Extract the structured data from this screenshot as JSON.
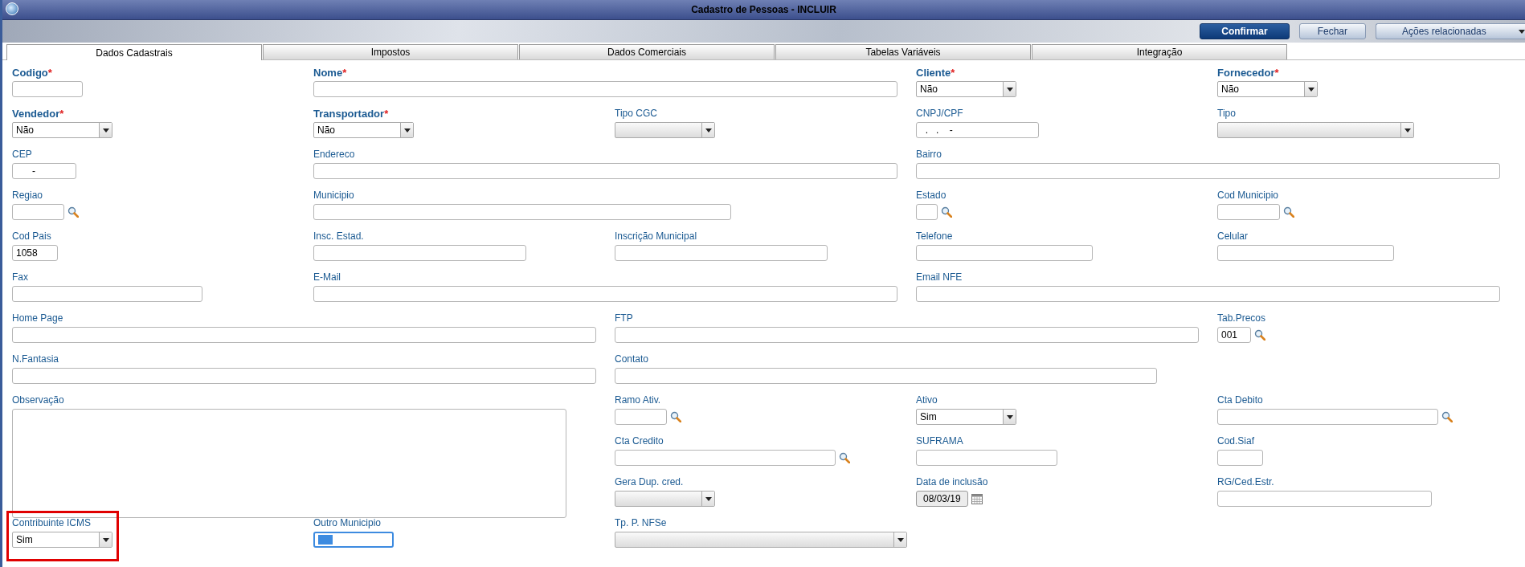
{
  "window": {
    "title": "Cadastro de Pessoas - INCLUIR"
  },
  "buttons": [
    {
      "label": "Confirmar",
      "kind": "primary"
    },
    {
      "label": "Fechar",
      "kind": "default"
    },
    {
      "label": "Ações relacionadas",
      "kind": "menu"
    }
  ],
  "tabs": [
    {
      "label": "Dados Cadastrais",
      "selected": true
    },
    {
      "label": "Impostos",
      "selected": false
    },
    {
      "label": "Dados Comerciais",
      "selected": false
    },
    {
      "label": "Tabelas Variáveis",
      "selected": false
    },
    {
      "label": "Integração",
      "selected": false
    }
  ],
  "fields": [
    {
      "label": "Codigo",
      "required_mark": "*",
      "kind": "text",
      "disabled": false,
      "focused": false,
      "highlighted": false
    },
    {
      "label": "Nome",
      "required_mark": "*",
      "kind": "text",
      "disabled": false,
      "focused": false,
      "highlighted": false
    },
    {
      "label": "Cliente",
      "required_mark": "*",
      "kind": "select",
      "value": "Não",
      "disabled": false,
      "focused": false,
      "highlighted": false
    },
    {
      "label": "Fornecedor",
      "required_mark": "*",
      "kind": "select",
      "value": "Não",
      "disabled": false,
      "focused": false,
      "highlighted": false
    },
    {
      "label": "Vendedor",
      "required_mark": "*",
      "kind": "select",
      "value": "Não",
      "disabled": false,
      "focused": false,
      "highlighted": false
    },
    {
      "label": "Transportador",
      "required_mark": "*",
      "kind": "select",
      "value": "Não",
      "disabled": false,
      "focused": false,
      "highlighted": false
    },
    {
      "label": "Tipo CGC",
      "kind": "select",
      "disabled": true,
      "focused": false,
      "highlighted": false
    },
    {
      "label": "CNPJ/CPF",
      "kind": "text",
      "value": "  .   .    -",
      "disabled": false,
      "focused": false,
      "highlighted": false
    },
    {
      "label": "Tipo",
      "kind": "select",
      "disabled": true,
      "focused": false,
      "highlighted": false
    },
    {
      "label": "CEP",
      "kind": "text",
      "value": "      -",
      "disabled": false,
      "focused": false,
      "highlighted": false
    },
    {
      "label": "Endereco",
      "kind": "text",
      "disabled": false,
      "focused": false,
      "highlighted": false
    },
    {
      "label": "Bairro",
      "kind": "text",
      "disabled": false,
      "focused": false,
      "highlighted": false
    },
    {
      "label": "Regiao",
      "kind": "lookup",
      "disabled": false,
      "focused": false,
      "highlighted": false
    },
    {
      "label": "Municipio",
      "kind": "text",
      "disabled": false,
      "focused": false,
      "highlighted": false
    },
    {
      "label": "Estado",
      "kind": "lookup",
      "disabled": false,
      "focused": false,
      "highlighted": false
    },
    {
      "label": "Cod Municipio",
      "kind": "lookup",
      "disabled": false,
      "focused": false,
      "highlighted": false
    },
    {
      "label": "Cod Pais",
      "kind": "text",
      "value": "1058",
      "disabled": false,
      "focused": false,
      "highlighted": false
    },
    {
      "label": "Insc. Estad.",
      "kind": "text",
      "disabled": false,
      "focused": false,
      "highlighted": false
    },
    {
      "label": "Inscrição Municipal",
      "kind": "text",
      "disabled": false,
      "focused": false,
      "highlighted": false
    },
    {
      "label": "Telefone",
      "kind": "text",
      "disabled": false,
      "focused": false,
      "highlighted": false
    },
    {
      "label": "Celular",
      "kind": "text",
      "disabled": false,
      "focused": false,
      "highlighted": false
    },
    {
      "label": "Fax",
      "kind": "text",
      "disabled": false,
      "focused": false,
      "highlighted": false
    },
    {
      "label": "E-Mail",
      "kind": "text",
      "disabled": false,
      "focused": false,
      "highlighted": false
    },
    {
      "label": "Email NFE",
      "kind": "text",
      "disabled": false,
      "focused": false,
      "highlighted": false
    },
    {
      "label": "Home Page",
      "kind": "text",
      "disabled": false,
      "focused": false,
      "highlighted": false
    },
    {
      "label": "FTP",
      "kind": "text",
      "disabled": false,
      "focused": false,
      "highlighted": false
    },
    {
      "label": "Tab.Precos",
      "kind": "lookup",
      "value": "001",
      "disabled": false,
      "focused": false,
      "highlighted": false
    },
    {
      "label": "N.Fantasia",
      "kind": "text",
      "disabled": false,
      "focused": false,
      "highlighted": false
    },
    {
      "label": "Contato",
      "kind": "text",
      "disabled": false,
      "focused": false,
      "highlighted": false
    },
    {
      "label": "Observação",
      "kind": "textarea",
      "disabled": false,
      "focused": false,
      "highlighted": false
    },
    {
      "label": "Ramo Ativ.",
      "kind": "lookup",
      "disabled": false,
      "focused": false,
      "highlighted": false
    },
    {
      "label": "Ativo",
      "kind": "select",
      "value": "Sim",
      "disabled": false,
      "focused": false,
      "highlighted": false
    },
    {
      "label": "Cta Debito",
      "kind": "lookup",
      "disabled": false,
      "focused": false,
      "highlighted": false
    },
    {
      "label": "Cta Credito",
      "kind": "lookup",
      "disabled": false,
      "focused": false,
      "highlighted": false
    },
    {
      "label": "SUFRAMA",
      "kind": "text",
      "disabled": false,
      "focused": false,
      "highlighted": false
    },
    {
      "label": "Cod.Siaf",
      "kind": "text",
      "disabled": false,
      "focused": false,
      "highlighted": false
    },
    {
      "label": "Gera Dup. cred.",
      "kind": "select",
      "disabled": true,
      "focused": false,
      "highlighted": false
    },
    {
      "label": "Data de inclusão",
      "kind": "date",
      "value": "08/03/19",
      "disabled": true,
      "focused": false,
      "highlighted": false
    },
    {
      "label": "RG/Ced.Estr.",
      "kind": "text",
      "disabled": false,
      "focused": false,
      "highlighted": false
    },
    {
      "label": "Contribuinte ICMS",
      "kind": "select",
      "value": "Sim",
      "disabled": false,
      "focused": false,
      "highlighted": true
    },
    {
      "label": "Outro Municipio",
      "kind": "text",
      "disabled": false,
      "focused": true,
      "highlighted": false
    },
    {
      "label": "Tp. P. NFSe",
      "kind": "select",
      "disabled": true,
      "focused": false,
      "highlighted": false
    }
  ]
}
